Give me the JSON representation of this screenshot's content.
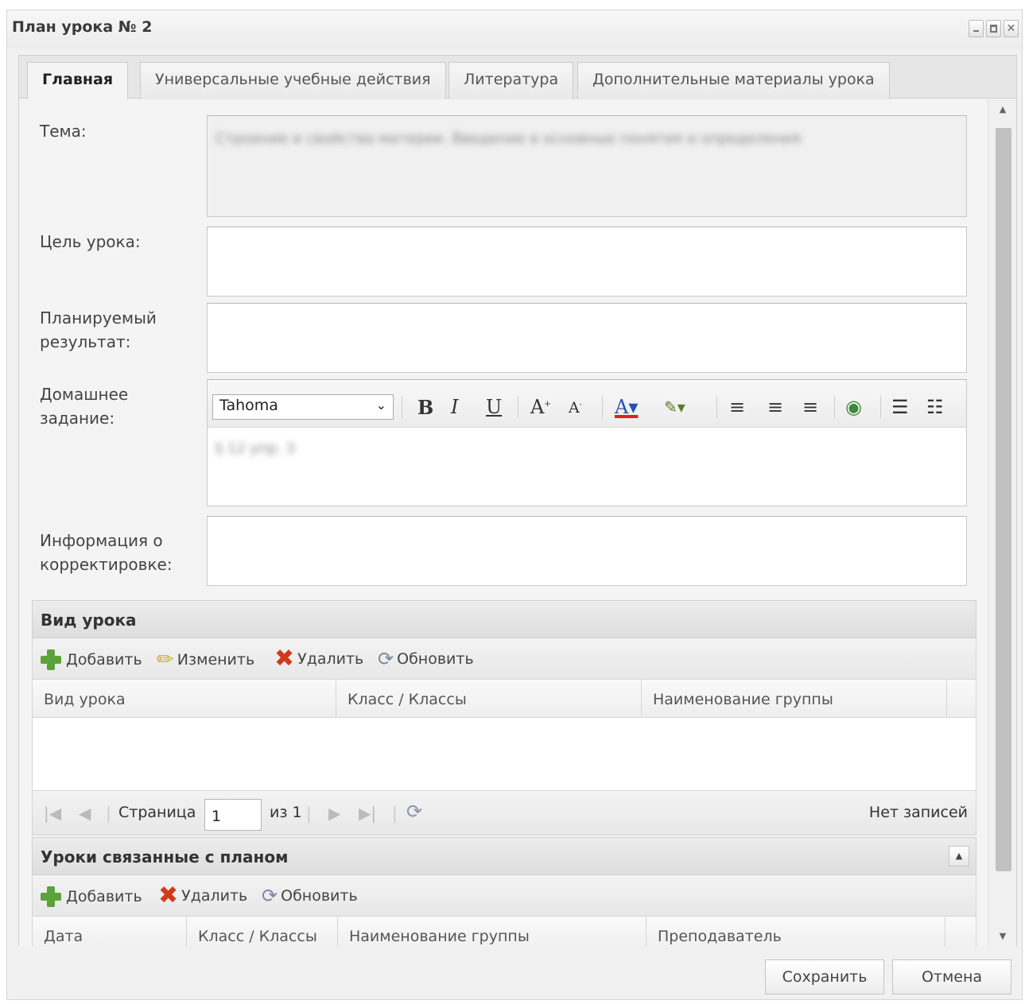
{
  "window": {
    "title": "План урока № 2"
  },
  "tabs": [
    {
      "label": "Главная"
    },
    {
      "label": "Универсальные учебные действия"
    },
    {
      "label": "Литература"
    },
    {
      "label": "Дополнительные материалы урока"
    }
  ],
  "form": {
    "topic_label": "Тема:",
    "topic_value": "Строение и свойства материи. Введение в основные понятия и определения",
    "goal_label": "Цель урока:",
    "goal_value": "",
    "result_label": "Планируемый результат:",
    "homework_label": "Домашнее задание:",
    "homework_font": "Tahoma",
    "homework_value": "§ 12 упр. 3",
    "correction_label": "Информация о корректировке:"
  },
  "editor_icons": [
    "bold-icon",
    "italic-icon",
    "underline-icon",
    "grow-font-icon",
    "shrink-font-icon",
    "font-color-icon",
    "highlight-icon",
    "align-left-icon",
    "align-center-icon",
    "align-right-icon",
    "link-icon",
    "ordered-list-icon",
    "unordered-list-icon"
  ],
  "lesson_type": {
    "title": "Вид урока",
    "add": "Добавить",
    "edit": "Изменить",
    "delete": "Удалить",
    "refresh": "Обновить",
    "columns": [
      "Вид урока",
      "Класс / Классы",
      "Наименование группы"
    ],
    "pager": {
      "page_label": "Страница",
      "page": "1",
      "of": "из 1",
      "empty": "Нет записей"
    }
  },
  "related_lessons": {
    "title": "Уроки связанные с планом",
    "add": "Добавить",
    "delete": "Удалить",
    "refresh": "Обновить",
    "columns": [
      "Дата",
      "Класс / Классы",
      "Наименование группы",
      "Преподаватель"
    ]
  },
  "footer": {
    "save": "Сохранить",
    "cancel": "Отмена"
  }
}
